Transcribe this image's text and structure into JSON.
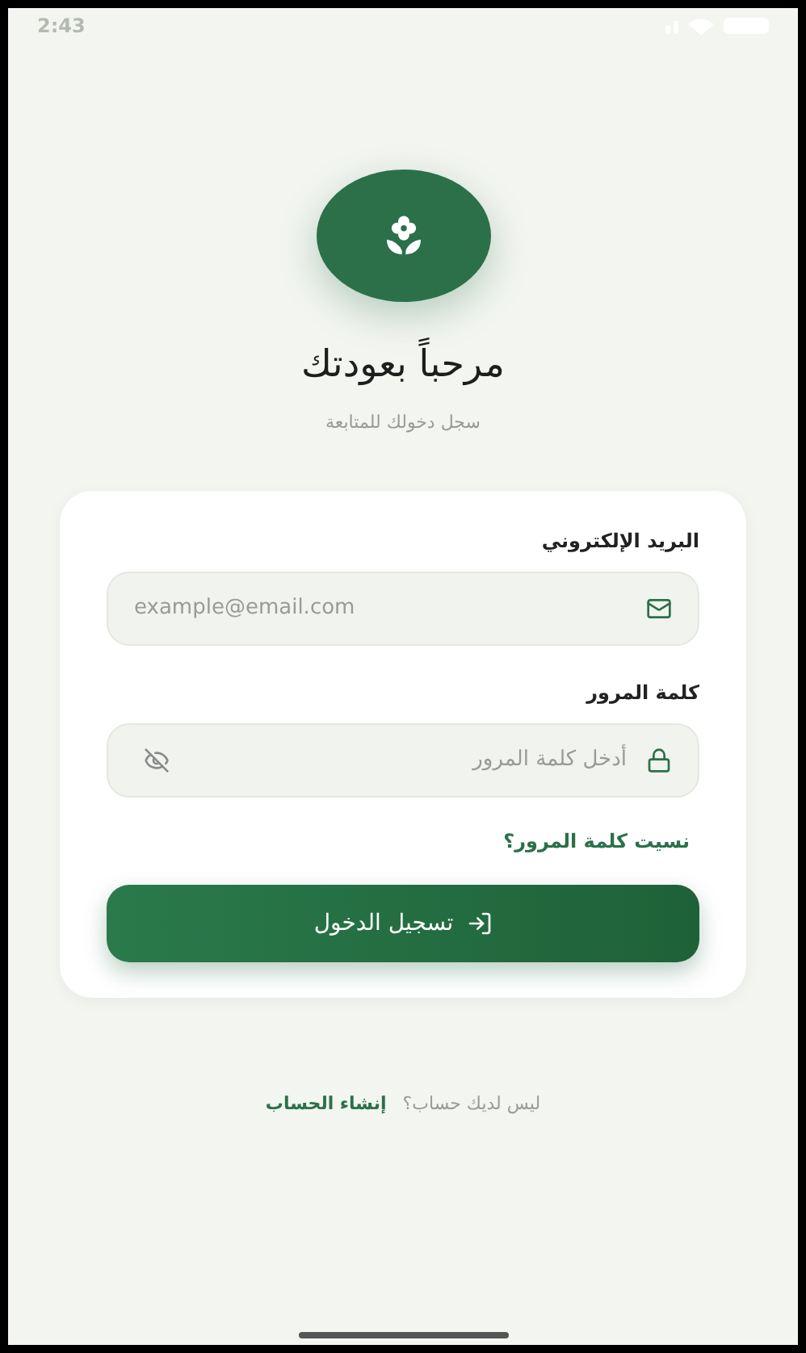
{
  "status_bar": {
    "time": "2:43"
  },
  "header": {
    "title": "مرحباً بعودتك",
    "subtitle": "سجل دخولك للمتابعة"
  },
  "form": {
    "fields": [
      {
        "label": "البريد الإلكتروني",
        "placeholder": "example@email.com",
        "kind": "email"
      },
      {
        "label": "كلمة المرور",
        "placeholder": "أدخل كلمة المرور",
        "kind": "password"
      }
    ],
    "forgot_link": "نسيت كلمة المرور؟",
    "submit": "تسجيل الدخول"
  },
  "footer": {
    "prompt": "ليس لديك حساب؟",
    "link": "إنشاء الحساب"
  }
}
